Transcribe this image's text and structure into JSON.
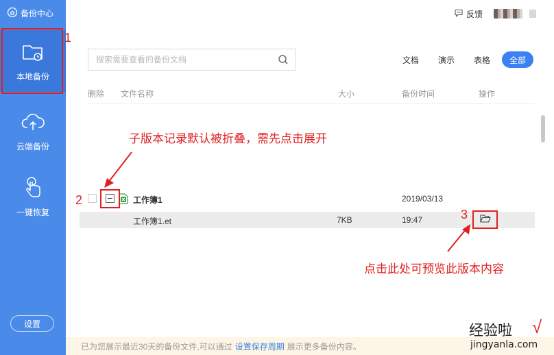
{
  "sidebar": {
    "brand": "备份中心",
    "items": [
      {
        "label": "本地备份",
        "icon": "folder-clock-icon",
        "active": true
      },
      {
        "label": "云端备份",
        "icon": "cloud-upload-icon",
        "active": false
      },
      {
        "label": "一键恢复",
        "icon": "hand-pointer-icon",
        "active": false
      }
    ],
    "settings_label": "设置"
  },
  "header": {
    "feedback_label": "反馈"
  },
  "search": {
    "placeholder": "搜索需要查看的备份文档",
    "value": ""
  },
  "filters": [
    {
      "label": "文档",
      "active": false
    },
    {
      "label": "演示",
      "active": false
    },
    {
      "label": "表格",
      "active": false
    },
    {
      "label": "全部",
      "active": true
    }
  ],
  "table": {
    "columns": [
      "删除",
      "文件名称",
      "大小",
      "备份时间",
      "操作"
    ],
    "group": {
      "name": "工作簿1",
      "date": "2019/03/13",
      "versions": [
        {
          "name": "工作簿1.et",
          "size": "7KB",
          "time": "19:47"
        }
      ]
    }
  },
  "footer": {
    "prefix": "已为您展示最近30天的备份文件,可以通过",
    "link": "设置保存周期",
    "suffix": "展示更多备份内容。"
  },
  "annotations": {
    "num1": "1",
    "num2": "2",
    "num3": "3",
    "note_collapse": "子版本记录默认被折叠，需先点击展开",
    "note_preview": "点击此处可预览此版本内容"
  },
  "watermark": {
    "title": "经验啦",
    "check": "√",
    "url": "jingyanla.com"
  },
  "colors": {
    "sidebar": "#4a8ae8",
    "sidebar_active": "#3b78dc",
    "accent": "#3b82f0",
    "annotation": "#e02020"
  }
}
